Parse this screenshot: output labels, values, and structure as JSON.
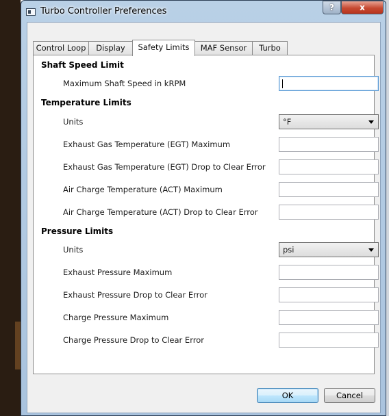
{
  "window": {
    "title": "Turbo Controller Preferences",
    "help_label": "?",
    "close_label": "x"
  },
  "tabs": [
    {
      "label": "Control Loop",
      "active": false
    },
    {
      "label": "Display",
      "active": false
    },
    {
      "label": "Safety Limits",
      "active": true
    },
    {
      "label": "MAF Sensor",
      "active": false
    },
    {
      "label": "Turbo",
      "active": false
    }
  ],
  "shaft": {
    "title": "Shaft Speed Limit",
    "max_label": "Maximum Shaft Speed in kRPM",
    "max_value": ""
  },
  "temperature": {
    "title": "Temperature Limits",
    "units_label": "Units",
    "units_value": "°F",
    "egt_max_label": "Exhaust Gas Temperature (EGT) Maximum",
    "egt_drop_label": "Exhaust Gas Temperature (EGT) Drop to Clear Error",
    "act_max_label": "Air Charge Temperature (ACT) Maximum",
    "act_drop_label": "Air Charge Temperature (ACT) Drop to Clear Error",
    "egt_max_value": "",
    "egt_drop_value": "",
    "act_max_value": "",
    "act_drop_value": ""
  },
  "pressure": {
    "title": "Pressure Limits",
    "units_label": "Units",
    "units_value": "psi",
    "exhaust_max_label": "Exhaust Pressure Maximum",
    "exhaust_drop_label": "Exhaust Pressure Drop to Clear Error",
    "charge_max_label": "Charge Pressure Maximum",
    "charge_drop_label": "Charge Pressure Drop to Clear Error",
    "exhaust_max_value": "",
    "exhaust_drop_value": "",
    "charge_max_value": "",
    "charge_drop_value": ""
  },
  "buttons": {
    "ok_label": "OK",
    "cancel_label": "Cancel"
  },
  "colors": {
    "title_bar": "#b9d0e6",
    "close_button": "#c64a32",
    "default_button_border": "#3c7fb1"
  }
}
